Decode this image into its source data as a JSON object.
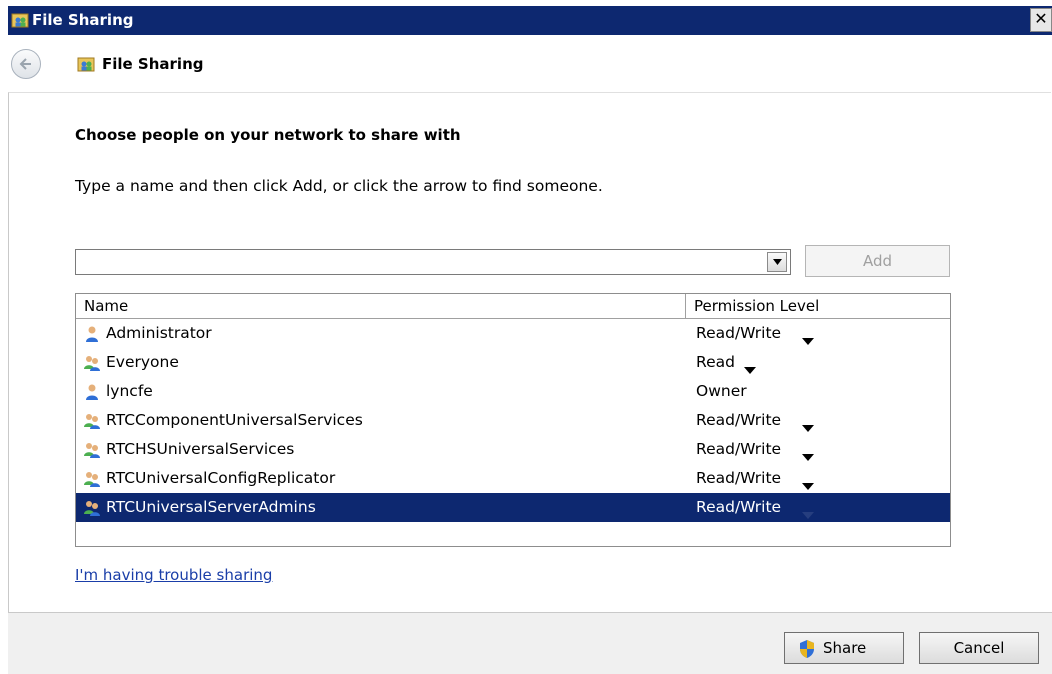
{
  "window": {
    "title": "File Sharing",
    "close_glyph": "✕"
  },
  "nav": {
    "title": "File Sharing",
    "back_icon": "back-arrow-icon"
  },
  "main": {
    "heading": "Choose people on your network to share with",
    "instruction": "Type a name and then click Add, or click the arrow to find someone.",
    "name_input": {
      "value": "",
      "placeholder": ""
    },
    "add_label": "Add"
  },
  "list": {
    "columns": [
      "Name",
      "Permission Level"
    ],
    "rows": [
      {
        "name": "Administrator",
        "permission": "Read/Write",
        "icon": "user-icon",
        "has_dropdown": true,
        "selected": false
      },
      {
        "name": "Everyone",
        "permission": "Read",
        "icon": "group-icon",
        "has_dropdown": true,
        "selected": false
      },
      {
        "name": "lyncfe",
        "permission": "Owner",
        "icon": "user-icon",
        "has_dropdown": false,
        "selected": false
      },
      {
        "name": "RTCComponentUniversalServices",
        "permission": "Read/Write",
        "icon": "group-icon",
        "has_dropdown": true,
        "selected": false
      },
      {
        "name": "RTCHSUniversalServices",
        "permission": "Read/Write",
        "icon": "group-icon",
        "has_dropdown": true,
        "selected": false
      },
      {
        "name": "RTCUniversalConfigReplicator",
        "permission": "Read/Write",
        "icon": "group-icon",
        "has_dropdown": true,
        "selected": false
      },
      {
        "name": "RTCUniversalServerAdmins",
        "permission": "Read/Write",
        "icon": "group-icon",
        "has_dropdown": true,
        "selected": true
      }
    ]
  },
  "trouble_link": "I'm having trouble sharing",
  "footer": {
    "share_label": "Share",
    "cancel_label": "Cancel"
  },
  "colors": {
    "titlebar": "#0d2870",
    "selection": "#0d2870",
    "link": "#1a3ea8"
  }
}
